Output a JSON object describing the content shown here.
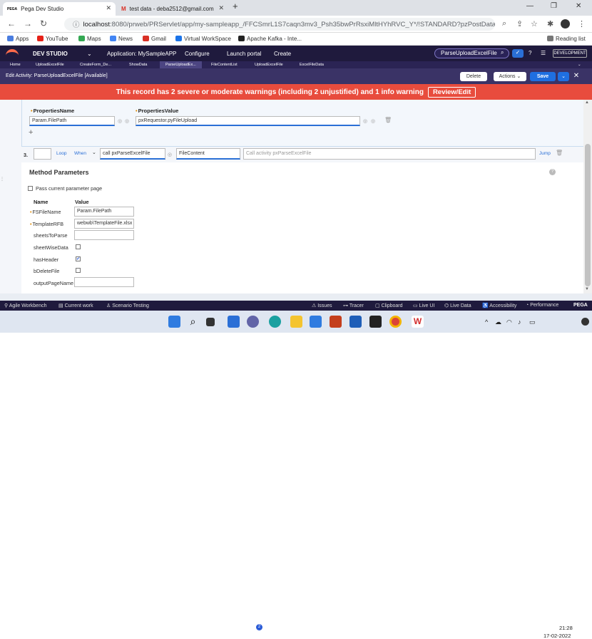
{
  "browser": {
    "tabs": [
      {
        "label": "Pega Dev Studio",
        "active": true
      },
      {
        "label": "test data - deba2512@gmail.com",
        "active": false
      }
    ],
    "new_tab": "+",
    "url_host": "localhost",
    "url_path": ":8080/prweb/PRServlet/app/my-sampleapp_/FFCSmrL1S7caqn3mv3_Psh35bwPrRsxiMltHYhRVC_Y*/!STANDARD?pzPostData=4040826",
    "bookmarks": [
      "Apps",
      "YouTube",
      "Maps",
      "News",
      "Gmail",
      "Virtual WorkSpace",
      "Apache Kafka - Inte..."
    ],
    "reading_list": "Reading list"
  },
  "pega_header": {
    "studio": "DEV STUDIO",
    "application": "Application: MySampleAPP",
    "menus": [
      "Configure",
      "Launch portal",
      "Create"
    ],
    "search_value": "ParseUploadExcelFile",
    "badge": "DEVELOPMENT"
  },
  "pega_tabs": [
    "Home",
    "UploadExcelFile",
    "CreateForm_De...",
    "ShowData",
    "ParseUploadEx...",
    "FileContentList",
    "UploadExcelFile",
    "ExcelFileData"
  ],
  "rule_bar": {
    "title": "Edit  Activity: ParseUploadExcelFile [Available]",
    "delete": "Delete",
    "actions": "Actions",
    "save": "Save"
  },
  "warning": {
    "text": "This record has 2 severe or moderate warnings (including 2 unjustified) and 1 info warning",
    "button": "Review/Edit"
  },
  "properties": {
    "name_label": "PropertiesName",
    "value_label": "PropertiesValue",
    "name_value": "Param.FilePath",
    "value_value": "pxRequestor.pyFileUpload",
    "add": "+"
  },
  "step": {
    "number": "3.",
    "loop": "Loop",
    "when": "When",
    "method": "call pxParseExcelFile",
    "step_page": "FileContent",
    "description_placeholder": "Call activity pxParseExcelFile",
    "jump": "Jump"
  },
  "method_params": {
    "title": "Method Parameters",
    "pass_current": "Pass current parameter page",
    "col_name": "Name",
    "col_value": "Value",
    "rows": [
      {
        "name": "FSFileName",
        "value": "Param.FilePath"
      },
      {
        "name": "TemplateRFB",
        "value": "webwb\\TemplateFile.xlsx"
      },
      {
        "name": "sheetsToParse",
        "value": ""
      },
      {
        "name": "sheetWiseData",
        "value": ""
      },
      {
        "name": "hasHeader",
        "value": "✔"
      },
      {
        "name": "bDeleteFile",
        "value": ""
      },
      {
        "name": "outputPageName",
        "value": ""
      }
    ]
  },
  "status_bar": [
    "Agile Workbench",
    "Current work",
    "Scenario Testing",
    "Issues",
    "Tracer",
    "Clipboard",
    "Live UI",
    "Live Data",
    "Accessibility",
    "Performance",
    "PEGA"
  ],
  "taskbar": {
    "time": "21:28",
    "date": "17-02-2022",
    "badge": "2"
  }
}
